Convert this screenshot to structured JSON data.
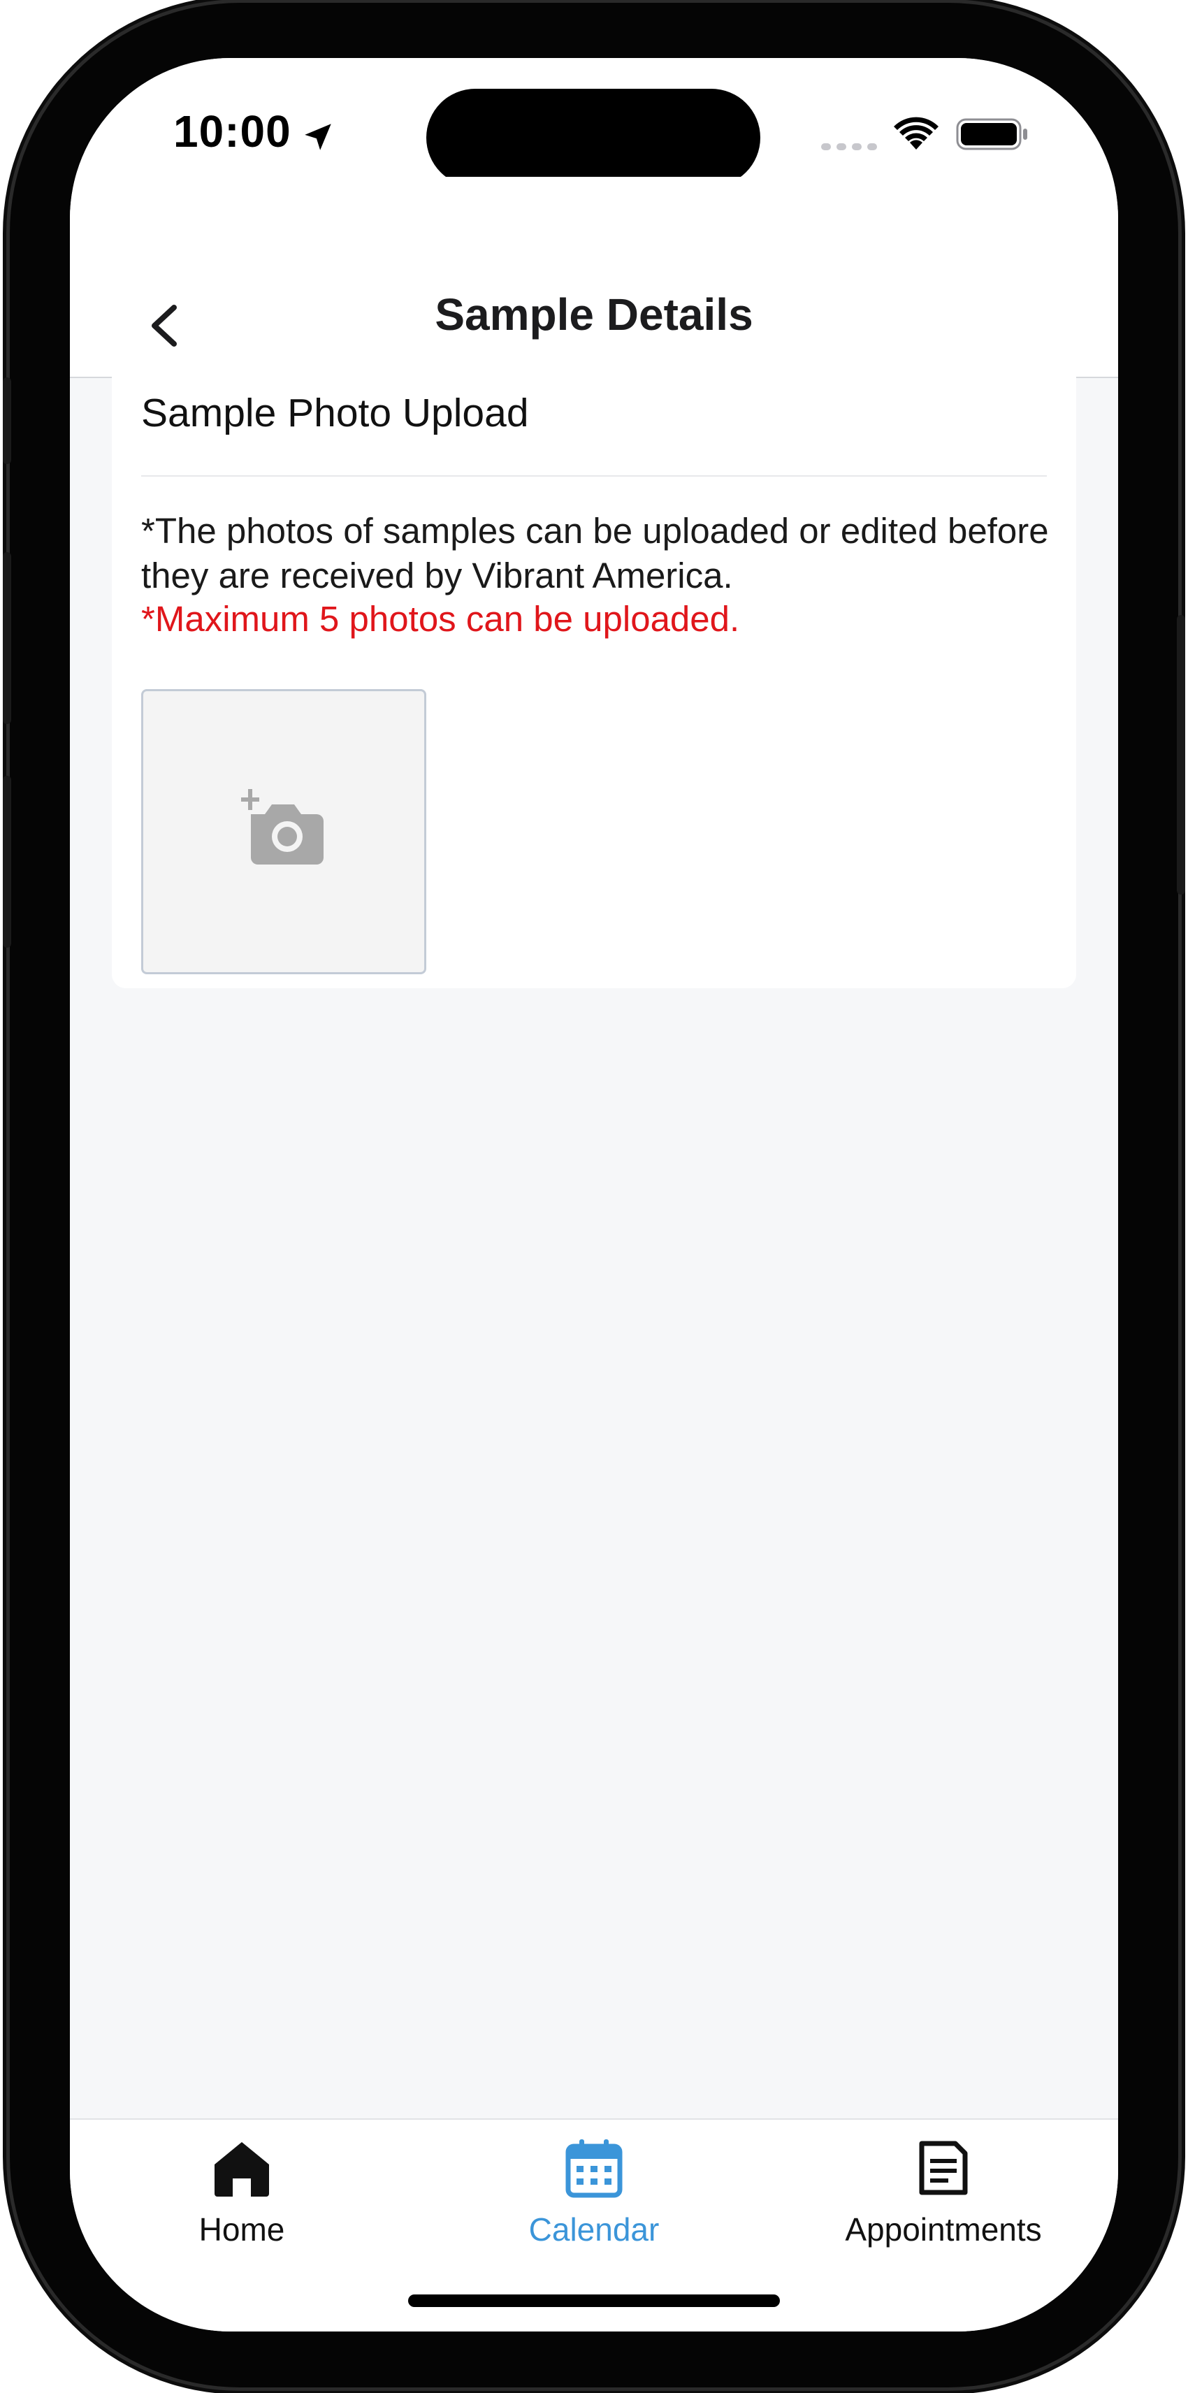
{
  "status_bar": {
    "time": "10:00",
    "icons": [
      "location-arrow-icon",
      "signal-icon",
      "wifi-icon",
      "battery-icon"
    ]
  },
  "nav": {
    "title": "Sample Details",
    "back_icon": "chevron-left-icon"
  },
  "card": {
    "title": "Sample Photo Upload",
    "description": "*The photos of samples can be uploaded or edited before they are received by Vibrant America.",
    "warning": "*Maximum 5 photos can be uploaded.",
    "upload_icon": "add-photo-icon"
  },
  "tabs": [
    {
      "label": "Home",
      "icon": "home-icon",
      "active": false
    },
    {
      "label": "Calendar",
      "icon": "calendar-icon",
      "active": true
    },
    {
      "label": "Appointments",
      "icon": "document-icon",
      "active": false
    }
  ],
  "colors": {
    "accent": "#3b95d9",
    "warning": "#e0161b",
    "background": "#f6f7f9",
    "tab_inactive": "#111111"
  }
}
